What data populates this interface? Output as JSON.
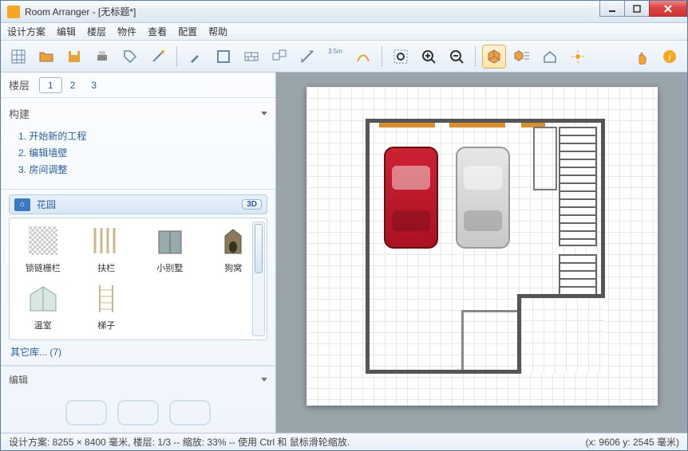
{
  "window": {
    "title": "Room Arranger - [无标题*]"
  },
  "menu": [
    "设计方案",
    "编辑",
    "楼层",
    "物件",
    "查看",
    "配置",
    "帮助"
  ],
  "toolbar": {
    "items": [
      {
        "name": "new-project-icon",
        "svg": "grid"
      },
      {
        "name": "open-icon",
        "svg": "folder"
      },
      {
        "name": "save-icon",
        "svg": "save"
      },
      {
        "name": "print-icon",
        "svg": "printer"
      },
      {
        "name": "export-icon",
        "svg": "tag"
      },
      {
        "name": "wizard-icon",
        "svg": "wand"
      },
      {
        "sep": true
      },
      {
        "name": "brush-icon",
        "svg": "brush"
      },
      {
        "name": "walls-icon",
        "svg": "walls"
      },
      {
        "name": "bricks-icon",
        "svg": "bricks"
      },
      {
        "name": "group-icon",
        "svg": "group"
      },
      {
        "name": "measure-icon",
        "svg": "measure"
      },
      {
        "name": "dim-icon",
        "svg": "dim",
        "text": "3.5m"
      },
      {
        "name": "path-icon",
        "svg": "path"
      },
      {
        "sep": true
      },
      {
        "name": "zoom-fit-icon",
        "svg": "zoomfit"
      },
      {
        "name": "zoom-in-icon",
        "svg": "zoomin"
      },
      {
        "name": "zoom-out-icon",
        "svg": "zoomout"
      },
      {
        "sep": true
      },
      {
        "name": "view-3d-icon",
        "svg": "cube",
        "active": true
      },
      {
        "name": "view-3d-list-icon",
        "svg": "cubelist"
      },
      {
        "name": "house-icon",
        "svg": "house"
      },
      {
        "name": "effects-icon",
        "svg": "spark"
      }
    ],
    "right": [
      {
        "name": "touch-icon",
        "svg": "hand"
      },
      {
        "name": "info-icon",
        "svg": "info"
      }
    ]
  },
  "sidebar": {
    "floors_label": "楼层",
    "floors": [
      "1",
      "2",
      "3"
    ],
    "floors_selected": 0,
    "build_label": "构建",
    "build_items": [
      "1.  开始新的工程",
      "2.  编辑墙壁",
      "3.  房间调整"
    ],
    "garden_label": "花园",
    "badge_3d": "3D",
    "objects": [
      {
        "label": "锁链栅栏"
      },
      {
        "label": "扶栏"
      },
      {
        "label": "小别墅"
      },
      {
        "label": "狗窝"
      },
      {
        "label": "温室"
      },
      {
        "label": "梯子"
      }
    ],
    "more_label": "其它库...  (7)",
    "edit_label": "编辑"
  },
  "status": {
    "left": "设计方案: 8255 × 8400 毫米, 楼层: 1/3 -- 缩放: 33% -- 使用 Ctrl 和 鼠标滑轮缩放.",
    "right": "(x: 9606 y: 2545 毫米)"
  }
}
